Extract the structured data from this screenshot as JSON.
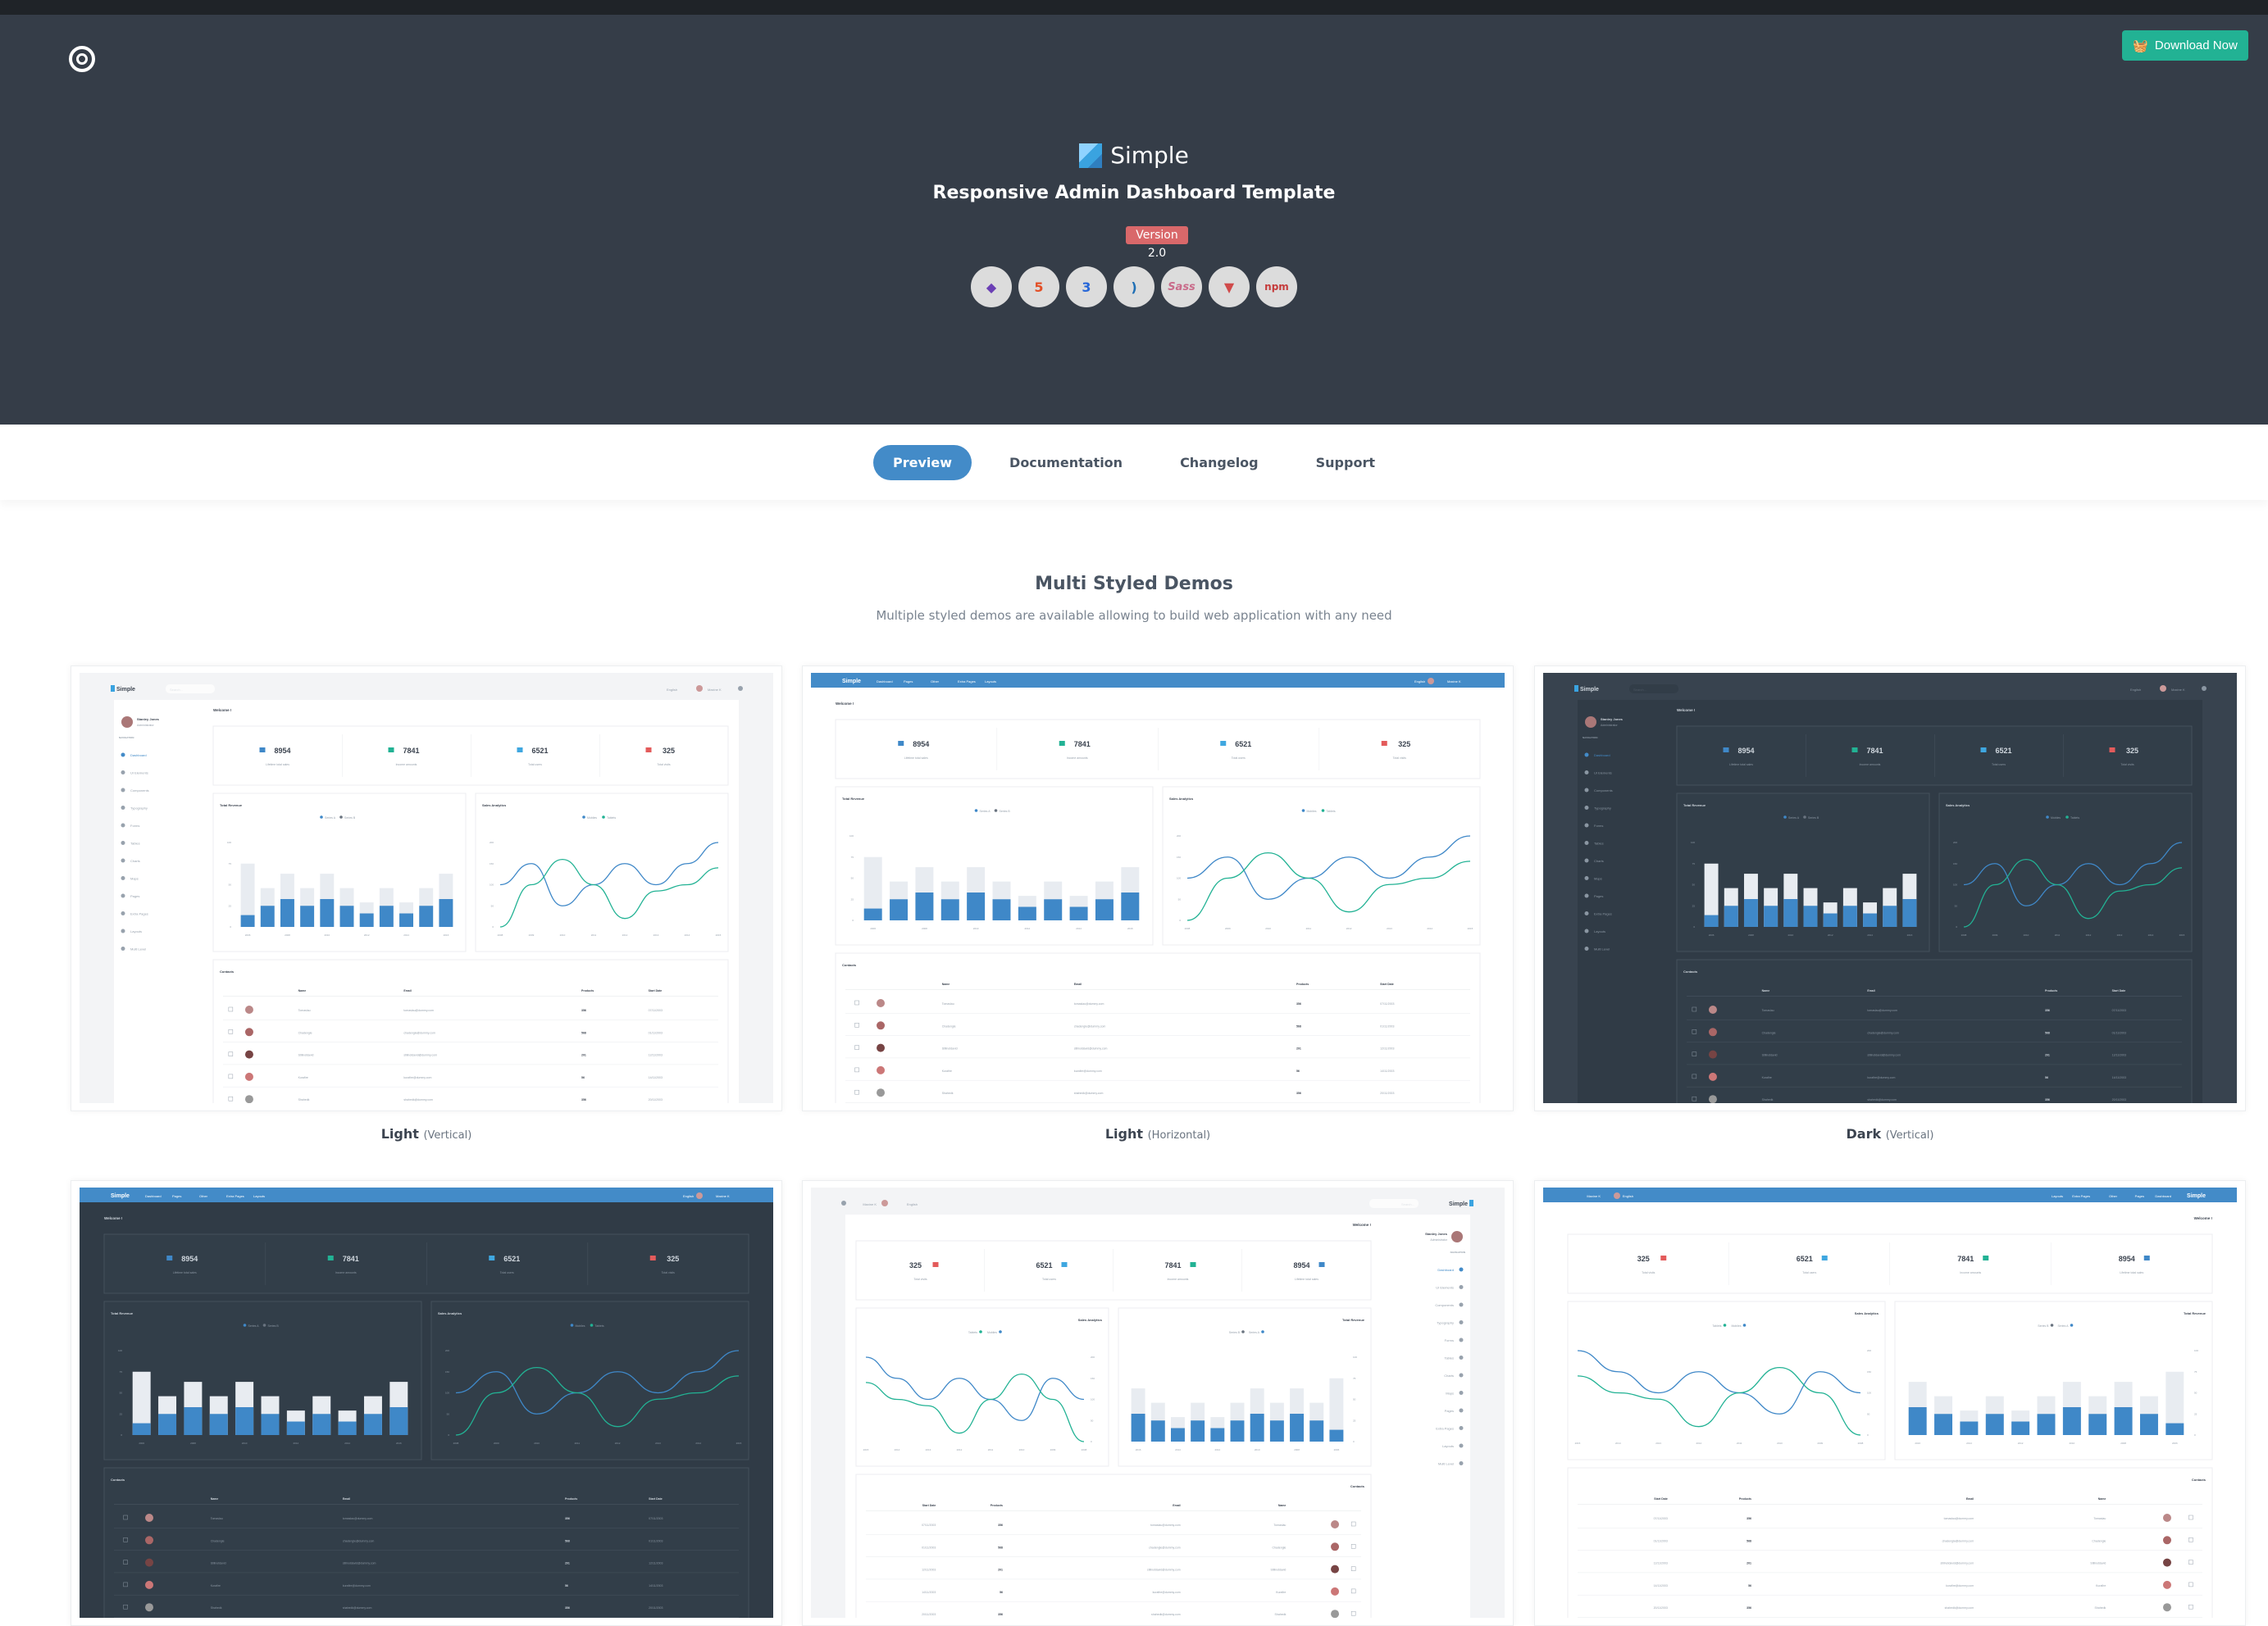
{
  "header": {
    "download_label": "Download Now",
    "brand": "Simple",
    "subtitle": "Responsive Admin Dashboard Template",
    "version": "Version 2.0",
    "tech_icons": [
      "bootstrap-icon",
      "html5-icon",
      "css3-icon",
      "jquery-icon",
      "sass-icon",
      "gulp-icon",
      "npm-icon"
    ],
    "colors": {
      "hero_bg": "#353d48",
      "download": "#22b294",
      "version": "#d9686a",
      "accent": "#438bc8"
    }
  },
  "nav": {
    "tabs": [
      {
        "label": "Preview",
        "active": true
      },
      {
        "label": "Documentation"
      },
      {
        "label": "Changelog"
      },
      {
        "label": "Support"
      }
    ]
  },
  "section": {
    "title": "Multi Styled Demos",
    "subtitle": "Multiple styled demos are available allowing to build web application with any need"
  },
  "demos": [
    {
      "name": "Light",
      "style": "(Vertical)",
      "theme": "light",
      "layout": "vertical",
      "rtl": false
    },
    {
      "name": "Light",
      "style": "(Horizontal)",
      "theme": "light",
      "layout": "horizontal",
      "rtl": false
    },
    {
      "name": "Dark",
      "style": "(Vertical)",
      "theme": "dark",
      "layout": "vertical",
      "rtl": false
    },
    {
      "theme": "dark",
      "layout": "horizontal",
      "rtl": false
    },
    {
      "theme": "light",
      "layout": "vertical",
      "rtl": true
    },
    {
      "theme": "light",
      "layout": "horizontal",
      "rtl": true
    }
  ],
  "dashboard": {
    "brand": "Simple",
    "search_placeholder": "Search...",
    "language": "English",
    "user_menu": "Maxine K",
    "user": {
      "name": "Stanley Jones",
      "role": "Administrator"
    },
    "nav_heading": "NAVIGATION",
    "sidebar": [
      "Dashboard",
      "UI Elements",
      "Components",
      "Typography",
      "Forms",
      "Tables",
      "Charts",
      "Maps",
      "Pages",
      "Extra Pages",
      "Layouts",
      "Multi Level"
    ],
    "top_menu": [
      "Dashboard",
      "Pages",
      "Other",
      "Extra Pages",
      "Layouts"
    ],
    "welcome": "Welcome !",
    "stats": [
      {
        "value": "8954",
        "label": "Lifetime total sales",
        "color": "#3f88c8"
      },
      {
        "value": "7841",
        "label": "Income amounts",
        "color": "#22b294"
      },
      {
        "value": "6521",
        "label": "Total users",
        "color": "#3fa7e0"
      },
      {
        "value": "325",
        "label": "Total visits",
        "color": "#e35b5b"
      }
    ],
    "contacts": {
      "title": "Contacts",
      "columns": [
        "Name",
        "Email",
        "Products",
        "Start Date"
      ],
      "rows": [
        [
          "Tomaslau",
          "tomaslau@dummy.com",
          "356",
          "07/11/2003"
        ],
        [
          "Chadengle",
          "chadengle@dummy.com",
          "568",
          "01/11/2003"
        ],
        [
          "Stillnotdavid",
          "stillnotdavid@dummy.com",
          "201",
          "12/11/2003"
        ],
        [
          "Kurafire",
          "kurafire@dummy.com",
          "56",
          "14/11/2003"
        ],
        [
          "Shahedk",
          "shahedk@dummy.com",
          "356",
          "20/11/2003"
        ]
      ]
    }
  },
  "chart_data": [
    {
      "type": "bar",
      "title": "Total Revenue",
      "categories": [
        "2006",
        "2007",
        "2008",
        "2009",
        "2010",
        "2011",
        "2012",
        "2013",
        "2014",
        "2015",
        "2016"
      ],
      "series": [
        {
          "name": "Series A",
          "values": [
            14,
            25,
            33,
            25,
            33,
            25,
            16,
            25,
            16,
            25,
            33
          ],
          "color": "#3f88c8"
        },
        {
          "name": "Series B",
          "values": [
            75,
            46,
            63,
            46,
            63,
            46,
            29,
            46,
            29,
            46,
            63
          ],
          "color": "#e8ecf1"
        }
      ],
      "ylim": [
        0,
        100
      ],
      "yticks": [
        0,
        25,
        50,
        75,
        100
      ]
    },
    {
      "type": "line",
      "title": "Sales Analytics",
      "categories": [
        "2008",
        "2009",
        "2010",
        "2011",
        "2012",
        "2013",
        "2014",
        "2015"
      ],
      "series": [
        {
          "name": "Mobiles",
          "values": [
            100,
            150,
            50,
            100,
            150,
            100,
            150,
            200
          ],
          "color": "#3f88c8"
        },
        {
          "name": "Tablets",
          "values": [
            0,
            100,
            160,
            100,
            20,
            85,
            100,
            140
          ],
          "color": "#22b294"
        }
      ],
      "ylim": [
        0,
        200
      ],
      "yticks": [
        0,
        50,
        100,
        150,
        200
      ]
    }
  ]
}
